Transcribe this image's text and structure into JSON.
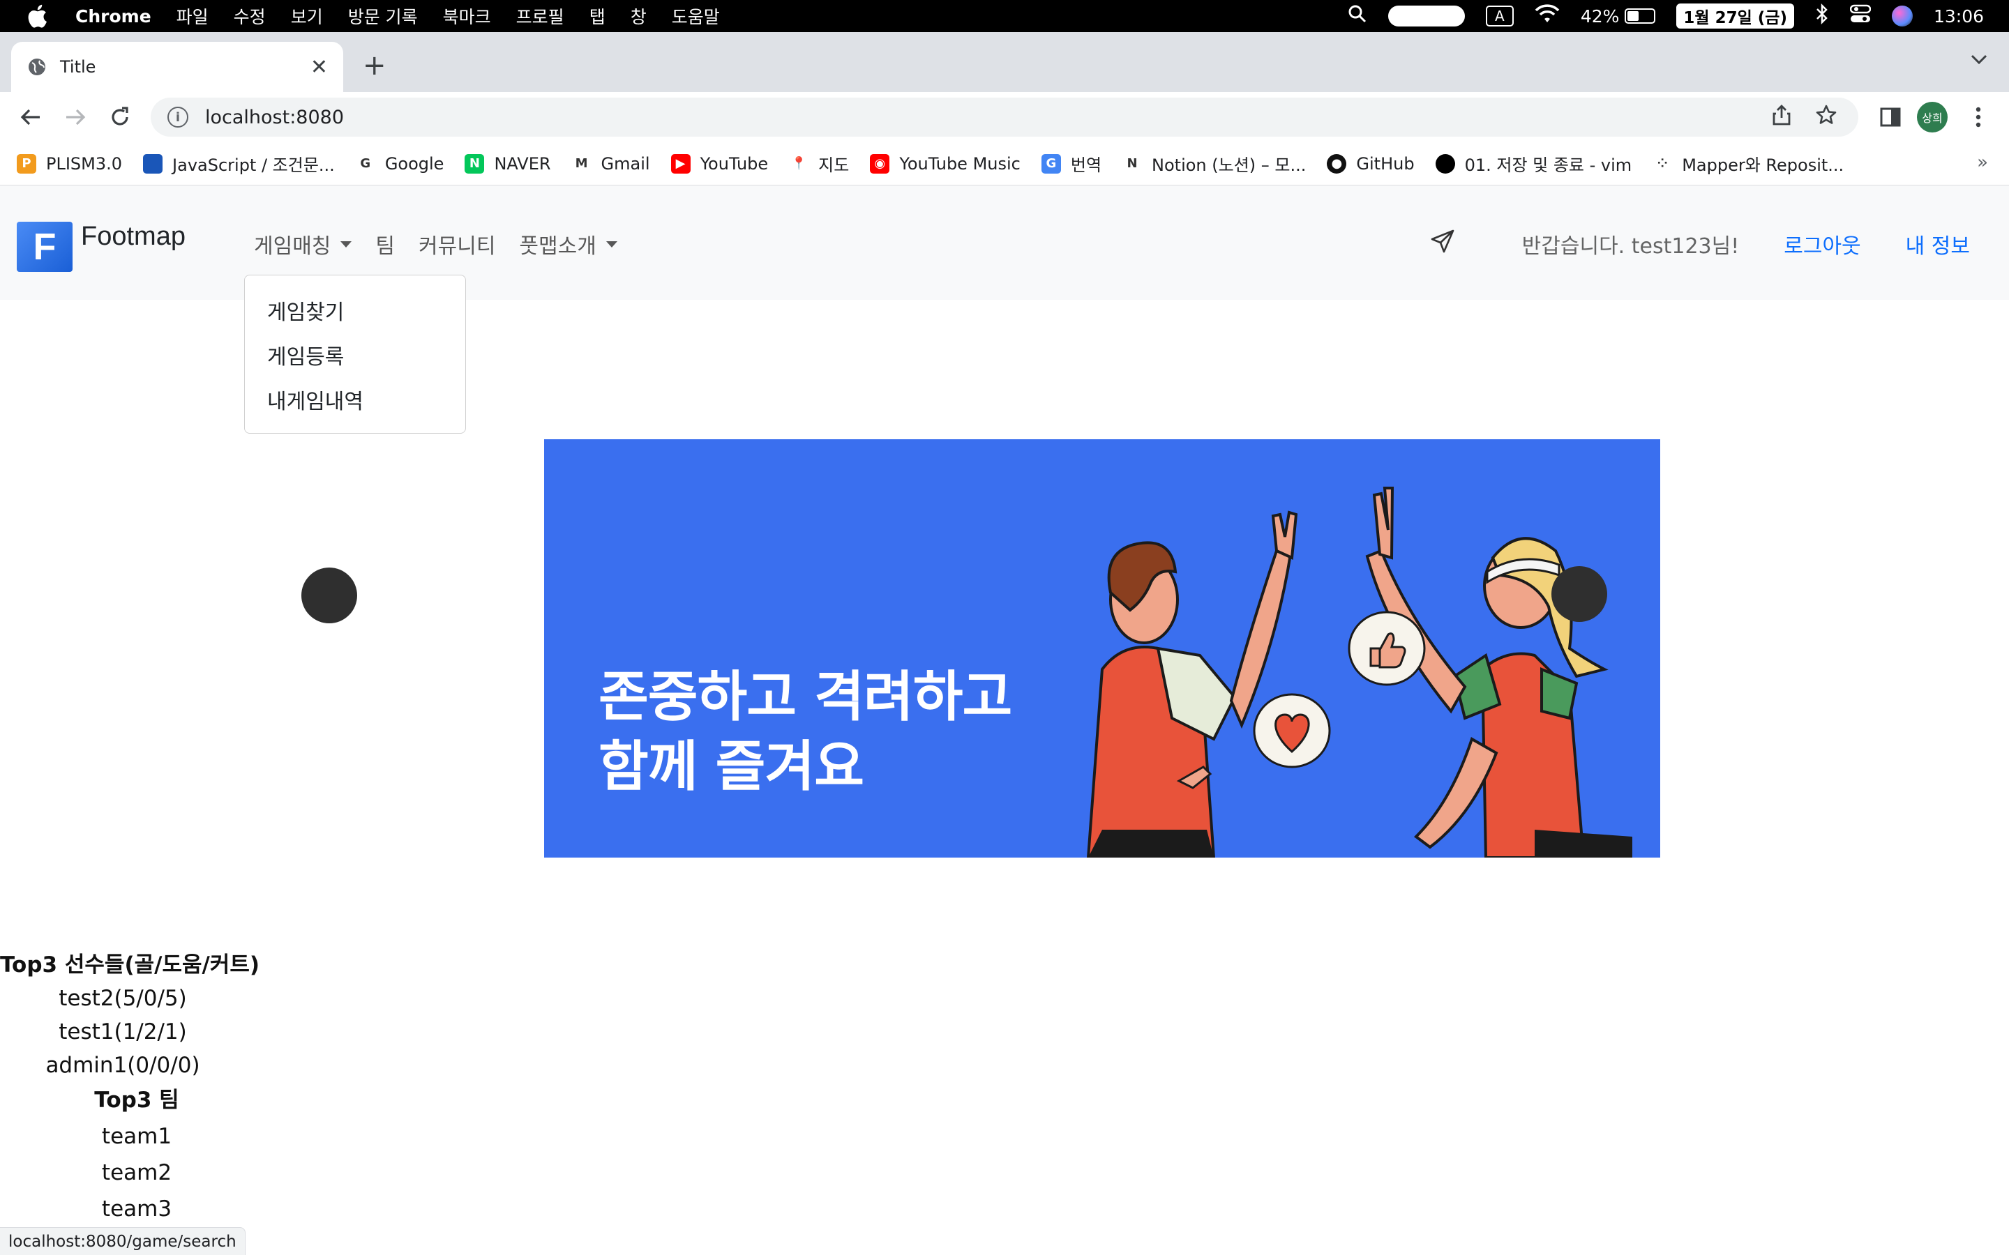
{
  "macos_menubar": {
    "app_name": "Chrome",
    "menus": [
      "파일",
      "수정",
      "보기",
      "방문 기록",
      "북마크",
      "프로필",
      "탭",
      "창",
      "도움말"
    ],
    "input_source": "A",
    "battery_percent_label": "42%",
    "battery_level": 0.42,
    "date": "1월 27일 (금)",
    "time": "13:06"
  },
  "browser": {
    "tab_title": "Title",
    "url": "localhost:8080",
    "profile_initials": "상희",
    "bookmarks": [
      {
        "label": "PLISM3.0",
        "icon": "plism-icon",
        "color": "#f29b1d",
        "glyph": "P"
      },
      {
        "label": "JavaScript / 조건문...",
        "icon": "bars-icon",
        "color": "#1a56b8",
        "glyph": ""
      },
      {
        "label": "Google",
        "icon": "google-icon",
        "color": "#ffffff",
        "glyph": "G"
      },
      {
        "label": "NAVER",
        "icon": "naver-icon",
        "color": "#03c75a",
        "glyph": "N"
      },
      {
        "label": "Gmail",
        "icon": "gmail-icon",
        "color": "#ffffff",
        "glyph": "M"
      },
      {
        "label": "YouTube",
        "icon": "youtube-icon",
        "color": "#ff0000",
        "glyph": "▶"
      },
      {
        "label": "지도",
        "icon": "maps-icon",
        "color": "#ffffff",
        "glyph": "📍"
      },
      {
        "label": "YouTube Music",
        "icon": "youtube-music-icon",
        "color": "#ff0000",
        "glyph": "◉"
      },
      {
        "label": "번역",
        "icon": "translate-icon",
        "color": "#4285f4",
        "glyph": "G"
      },
      {
        "label": "Notion (노션) – 모...",
        "icon": "notion-icon",
        "color": "#ffffff",
        "glyph": "N"
      },
      {
        "label": "GitHub",
        "icon": "github-icon",
        "color": "#111111",
        "glyph": "●"
      },
      {
        "label": "01. 저장 및 종료 - vim",
        "icon": "circle-icon",
        "color": "#000000",
        "glyph": ""
      },
      {
        "label": "Mapper와 Reposit...",
        "icon": "dots-icon",
        "color": "#ffffff",
        "glyph": "⁘"
      }
    ],
    "status_url": "localhost:8080/game/search"
  },
  "site": {
    "brand_letter": "F",
    "brand_name": "Footmap",
    "nav": {
      "game_matching": "게임매칭",
      "team": "팀",
      "community": "커뮤니티",
      "about": "풋맵소개"
    },
    "dropdown_items": [
      "게임찾기",
      "게임등록",
      "내게임내역"
    ],
    "greeting": "반갑습니다. test123님!",
    "logout": "로그아웃",
    "my_info": "내 정보",
    "hero_line1": "존중하고 격려하고",
    "hero_line2": "함께 즐겨요",
    "top_players_title": "Top3 선수들(골/도움/커트)",
    "top_players": [
      "test2(5/0/5)",
      "test1(1/2/1)",
      "admin1(0/0/0)"
    ],
    "top_teams_title": "Top3 팀",
    "top_teams": [
      "team1",
      "team2",
      "team3"
    ]
  }
}
